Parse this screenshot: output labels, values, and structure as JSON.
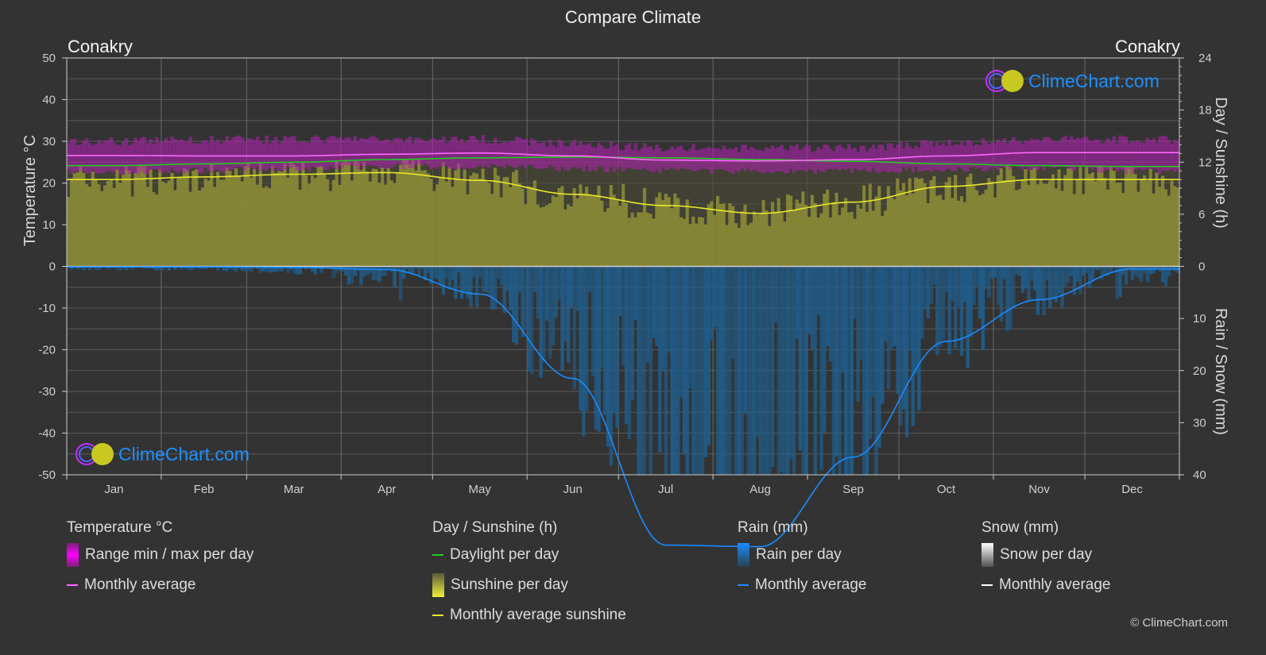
{
  "title": "Compare Climate",
  "city_left": "Conakry",
  "city_right": "Conakry",
  "logo_text": "ClimeChart.com",
  "copyright": "© ClimeChart.com",
  "colors": {
    "background": "#333333",
    "grid": "#5a5a5a",
    "temp_range": "#b020b0",
    "temp_avg": "#ff66ff",
    "daylight": "#22cc22",
    "sunshine_fill": "#8a8a36",
    "sunshine_avg": "#e8e82a",
    "rain_fill": "#1f5f8f",
    "rain_avg": "#1a8cff",
    "snow_avg": "#ffffff",
    "logo_blue": "#1e90ff"
  },
  "legend": {
    "temperature": {
      "header": "Temperature °C",
      "items": [
        "Range min / max per day",
        "Monthly average"
      ]
    },
    "sunshine": {
      "header": "Day / Sunshine (h)",
      "items": [
        "Daylight per day",
        "Sunshine per day",
        "Monthly average sunshine"
      ]
    },
    "rain": {
      "header": "Rain (mm)",
      "items": [
        "Rain per day",
        "Monthly average"
      ]
    },
    "snow": {
      "header": "Snow (mm)",
      "items": [
        "Snow per day",
        "Monthly average"
      ]
    }
  },
  "chart_data": {
    "type": "line",
    "title": "Compare Climate",
    "categories": [
      "Jan",
      "Feb",
      "Mar",
      "Apr",
      "May",
      "Jun",
      "Jul",
      "Aug",
      "Sep",
      "Oct",
      "Nov",
      "Dec"
    ],
    "left_axis": {
      "label": "Temperature °C",
      "range": [
        -50,
        50
      ],
      "ticks": [
        50,
        40,
        30,
        20,
        10,
        0,
        -10,
        -20,
        -30,
        -40,
        -50
      ]
    },
    "right_axis_top": {
      "label": "Day / Sunshine (h)",
      "range": [
        0,
        24
      ],
      "ticks": [
        24,
        18,
        12,
        6,
        0
      ]
    },
    "right_axis_bottom": {
      "label": "Rain / Snow (mm)",
      "range": [
        0,
        40
      ],
      "ticks": [
        0,
        10,
        20,
        30,
        40
      ]
    },
    "grid": true,
    "legend_position": "bottom",
    "series": [
      {
        "name": "Temperature monthly average",
        "unit": "°C",
        "values": [
          26.6,
          26.5,
          26.5,
          26.9,
          27.2,
          26.5,
          25.5,
          25.3,
          25.6,
          26.5,
          27.3,
          27.3
        ]
      },
      {
        "name": "Temperature range min",
        "unit": "°C",
        "values": [
          22.5,
          23.0,
          23.5,
          24.0,
          24.0,
          23.5,
          23.0,
          22.8,
          23.0,
          23.3,
          23.5,
          22.8
        ]
      },
      {
        "name": "Temperature range max",
        "unit": "°C",
        "values": [
          30.0,
          30.5,
          30.5,
          30.5,
          30.5,
          29.5,
          28.5,
          28.2,
          28.5,
          29.5,
          30.5,
          30.5
        ]
      },
      {
        "name": "Daylight per day",
        "unit": "h",
        "values": [
          11.6,
          11.8,
          12.0,
          12.3,
          12.5,
          12.6,
          12.5,
          12.3,
          12.1,
          11.8,
          11.6,
          11.5
        ]
      },
      {
        "name": "Monthly average sunshine",
        "unit": "h",
        "values": [
          10.0,
          10.3,
          10.6,
          10.8,
          9.9,
          8.3,
          7.0,
          6.1,
          7.4,
          9.2,
          10.0,
          10.0
        ]
      },
      {
        "name": "Rain monthly average",
        "unit": "mm",
        "values": [
          0.1,
          0.1,
          0.2,
          0.6,
          5.3,
          21.5,
          53.5,
          53.8,
          36.6,
          14.4,
          6.4,
          0.5
        ]
      },
      {
        "name": "Snow monthly average",
        "unit": "mm",
        "values": [
          0,
          0,
          0,
          0,
          0,
          0,
          0,
          0,
          0,
          0,
          0,
          0
        ]
      }
    ]
  }
}
